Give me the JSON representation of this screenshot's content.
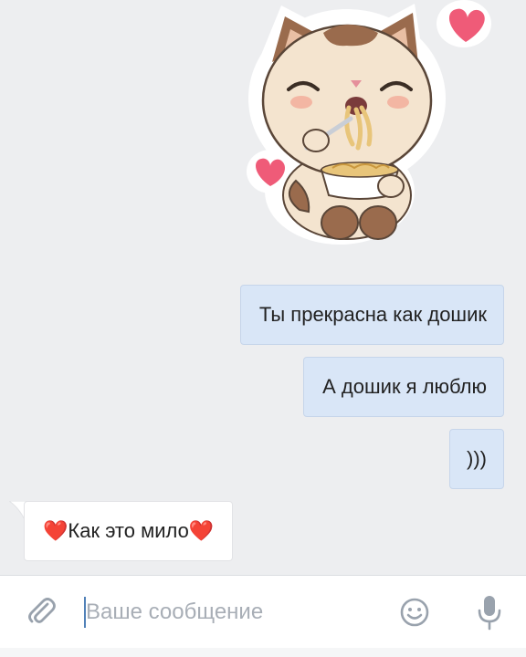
{
  "messages": [
    {
      "direction": "outgoing",
      "text": "Ты прекрасна как дошик"
    },
    {
      "direction": "outgoing",
      "text": "А дошик я люблю"
    },
    {
      "direction": "outgoing",
      "text": ")))"
    },
    {
      "direction": "incoming",
      "heart_left": "❤️",
      "text": "Как это мило",
      "heart_right": "❤️"
    }
  ],
  "sticker": {
    "icon": "cat-eating-noodles-sticker"
  },
  "composer": {
    "placeholder": "Ваше сообщение",
    "attach_icon": "paperclip-icon",
    "emoji_icon": "smiley-icon",
    "mic_icon": "microphone-icon"
  },
  "colors": {
    "background": "#edeef0",
    "outgoing_bubble": "#d9e6f7",
    "incoming_bubble": "#ffffff",
    "icon_gray": "#99a2ad",
    "accent": "#5181b8"
  }
}
